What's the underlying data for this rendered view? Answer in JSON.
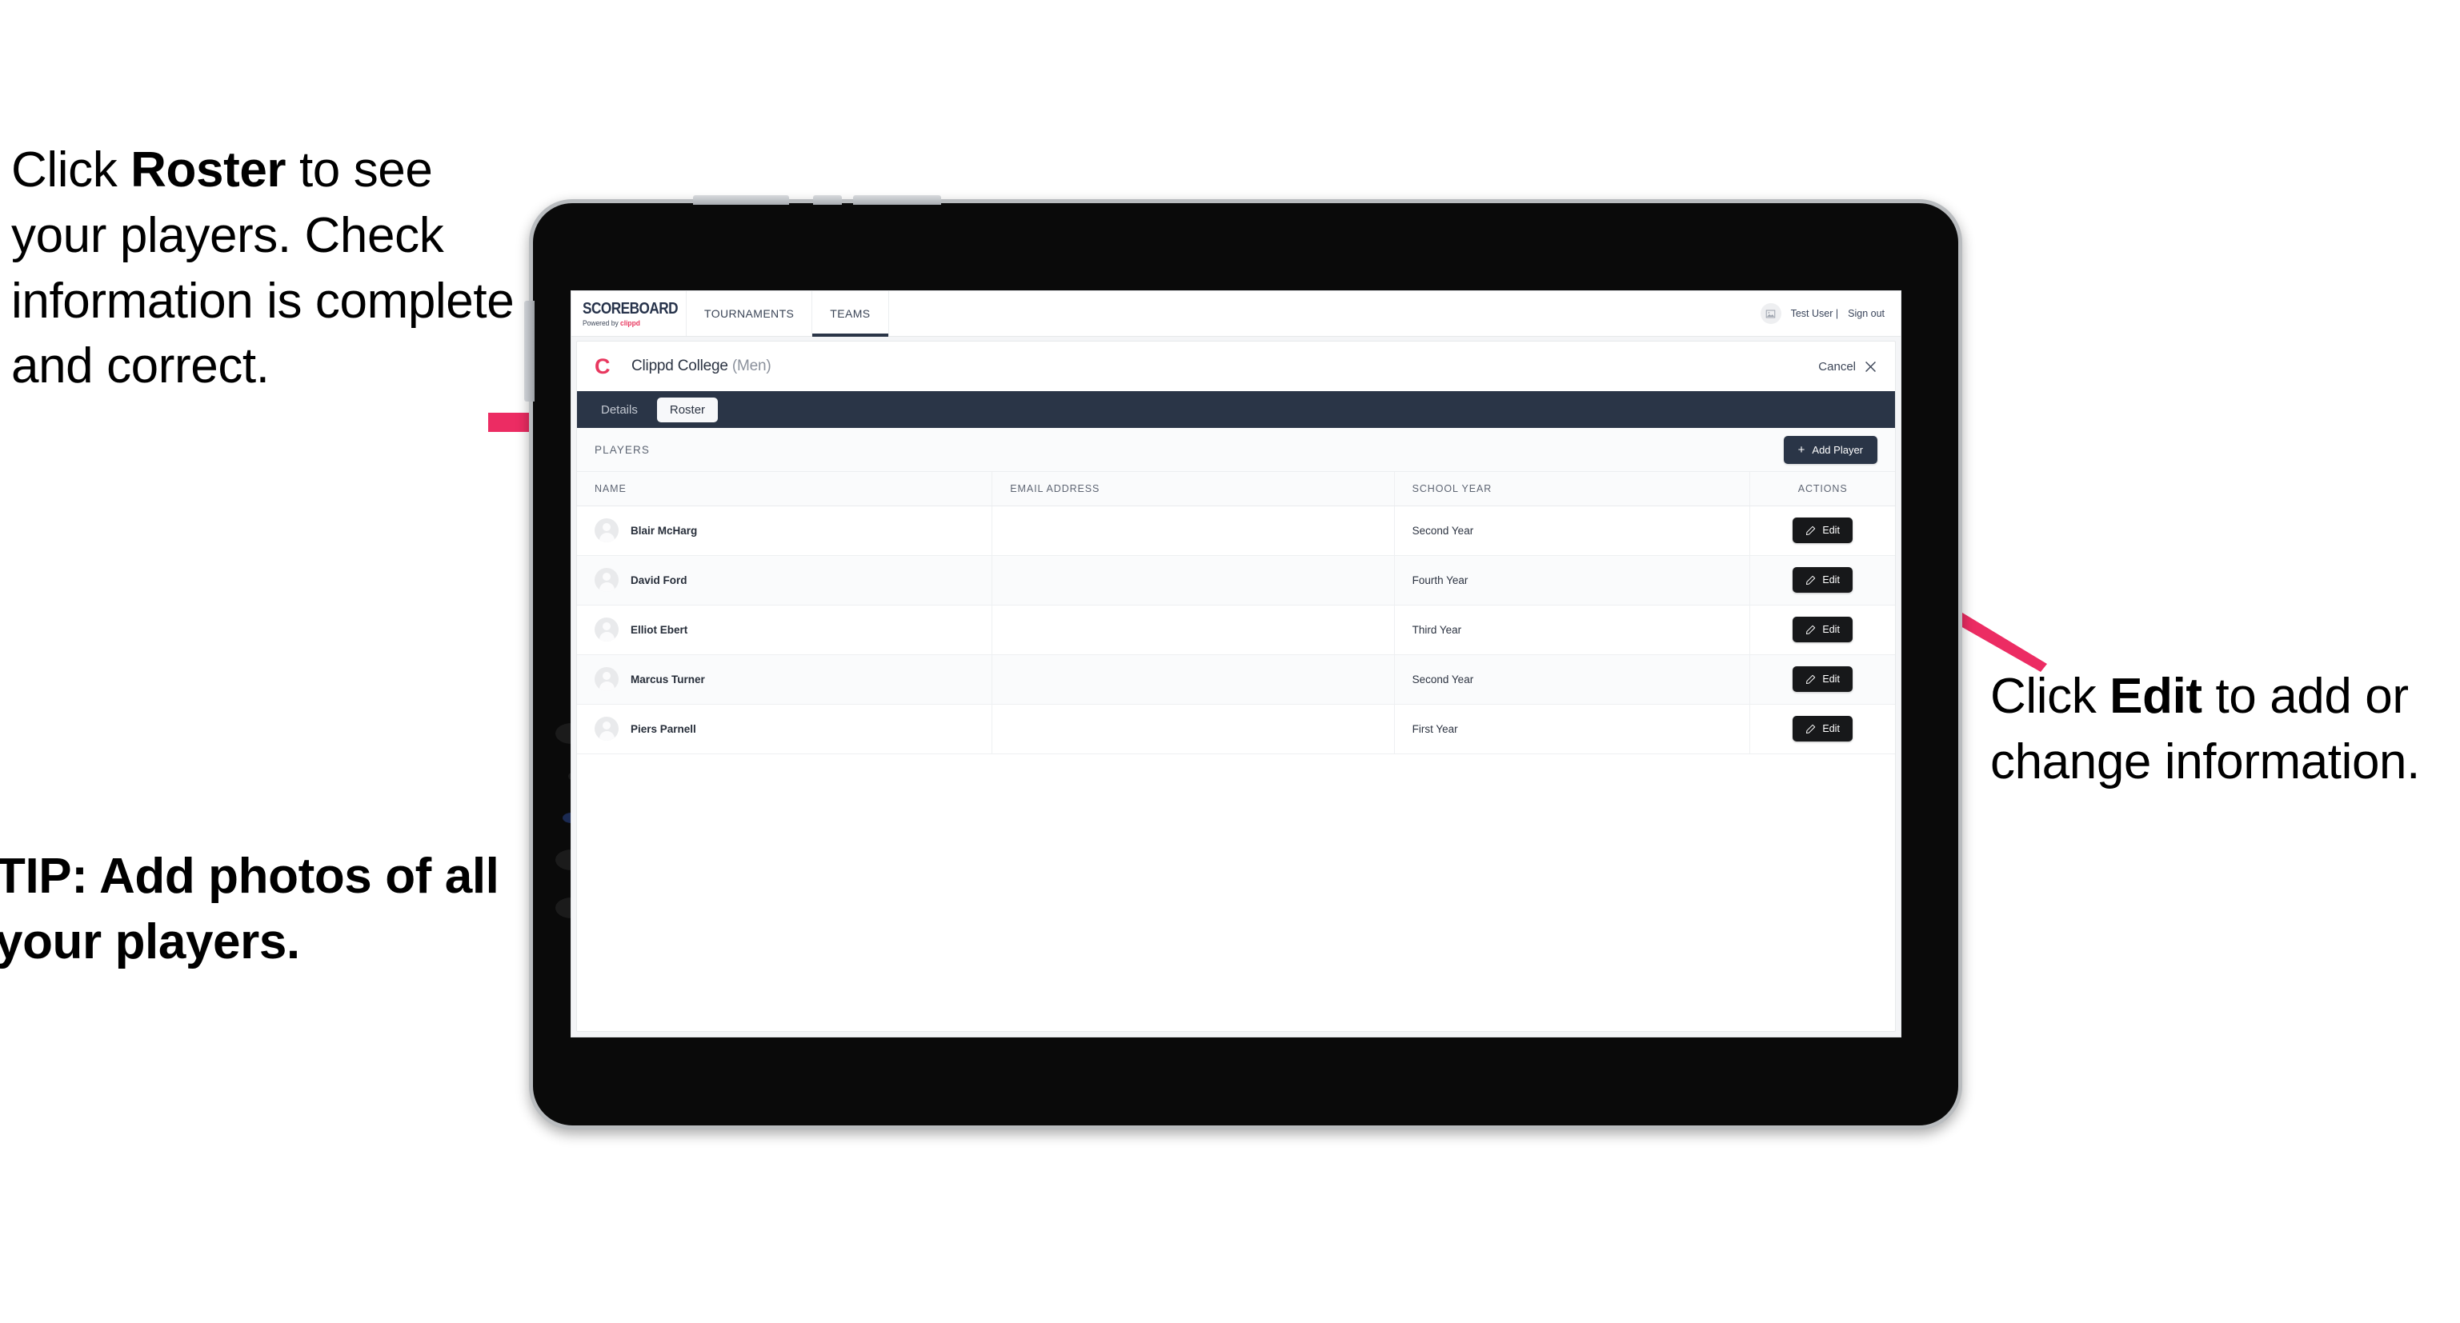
{
  "annotations": {
    "left": {
      "prefix": "Click ",
      "bold": "Roster",
      "suffix": " to see your players. Check information is complete and correct."
    },
    "tip": "TIP: Add photos of all your players.",
    "right": {
      "prefix": "Click ",
      "bold": "Edit",
      "suffix": " to add or change information."
    },
    "arrow_color": "#ec2c63"
  },
  "app": {
    "topnav": {
      "brand_title": "SCOREBOARD",
      "brand_sub_prefix": "Powered by ",
      "brand_sub_brand": "clippd",
      "tabs": [
        {
          "label": "TOURNAMENTS",
          "active": false
        },
        {
          "label": "TEAMS",
          "active": true
        }
      ],
      "user_name": "Test User |",
      "sign_out": "Sign out",
      "avatar_icon": "image-placeholder-icon"
    },
    "card_header": {
      "team_logo_letter": "C",
      "team_name": "Clippd College",
      "team_gender": "(Men)",
      "cancel_label": "Cancel",
      "cancel_icon": "close-x-icon"
    },
    "tabstrip": [
      {
        "label": "Details",
        "active": false
      },
      {
        "label": "Roster",
        "active": true
      }
    ],
    "players_bar": {
      "section_label": "PLAYERS",
      "add_player_label": "Add Player",
      "add_player_icon": "plus-icon"
    },
    "table": {
      "columns": [
        "NAME",
        "EMAIL ADDRESS",
        "SCHOOL YEAR",
        "ACTIONS"
      ],
      "rows": [
        {
          "name": "Blair McHarg",
          "email": "",
          "school_year": "Second Year",
          "action_label": "Edit"
        },
        {
          "name": "David Ford",
          "email": "",
          "school_year": "Fourth Year",
          "action_label": "Edit"
        },
        {
          "name": "Elliot Ebert",
          "email": "",
          "school_year": "Third Year",
          "action_label": "Edit"
        },
        {
          "name": "Marcus Turner",
          "email": "",
          "school_year": "Second Year",
          "action_label": "Edit"
        },
        {
          "name": "Piers Parnell",
          "email": "",
          "school_year": "First Year",
          "action_label": "Edit"
        }
      ]
    },
    "colors": {
      "navy": "#2a3547",
      "pink": "#e8385f",
      "edit_button": "#17181a"
    }
  }
}
